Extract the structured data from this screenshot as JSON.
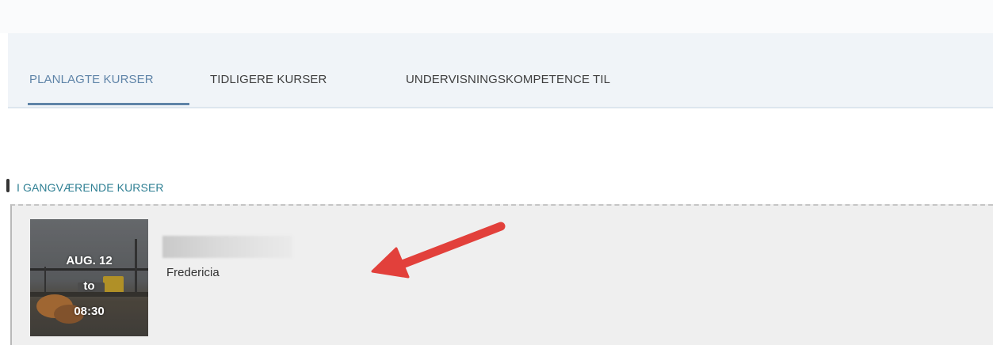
{
  "tabs": [
    {
      "label": "PLANLAGTE KURSER",
      "active": true
    },
    {
      "label": "TIDLIGERE KURSER",
      "active": false
    },
    {
      "label": "UNDERVISNINGSKOMPETENCE TIL",
      "active": false
    }
  ],
  "section": {
    "title": "I GANGVÆRENDE KURSER"
  },
  "course": {
    "date": "AUG. 12",
    "separator": "to",
    "time": "08:30",
    "location": "Fredericia"
  },
  "colors": {
    "accent": "#5f84a8",
    "section_title": "#2e7f93",
    "annotation_arrow": "#e2403b"
  }
}
